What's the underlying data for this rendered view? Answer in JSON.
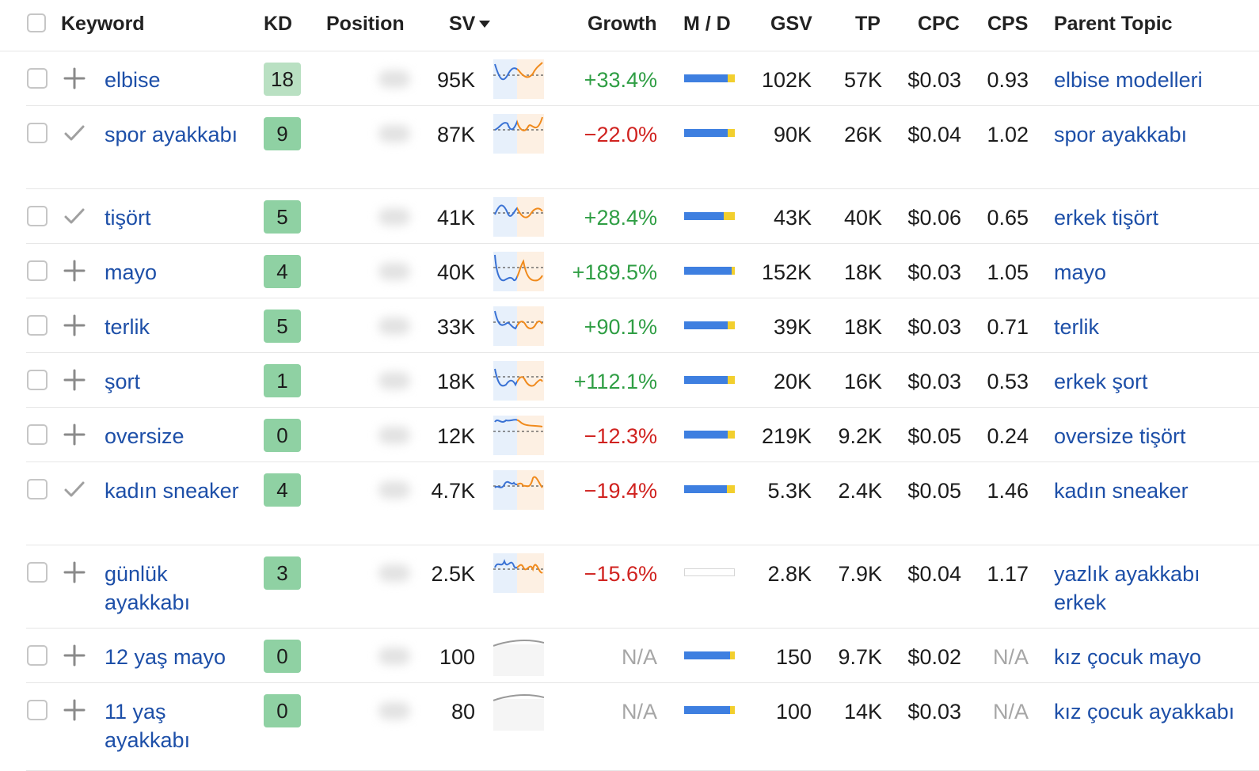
{
  "header": {
    "keyword": "Keyword",
    "kd": "KD",
    "position": "Position",
    "sv": "SV",
    "growth": "Growth",
    "md": "M / D",
    "gsv": "GSV",
    "tp": "TP",
    "cpc": "CPC",
    "cps": "CPS",
    "parent": "Parent Topic"
  },
  "colors": {
    "link": "#1d4fa8",
    "positive": "#2f9e44",
    "negative": "#d0221f",
    "kd_light": "#b9e0c2",
    "kd_green": "#8fd1a3",
    "md_mobile": "#3e7fe0",
    "md_desktop": "#f2cf2e"
  },
  "rows": [
    {
      "keyword": "elbise",
      "action": "plus-icon",
      "kd": "18",
      "sv": "95K",
      "growth": "+33.4%",
      "growth_type": "positive",
      "trend": "seasonal",
      "md_mobile": 0.86,
      "gsv": "102K",
      "tp": "57K",
      "cpc": "$0.03",
      "cps": "0.93",
      "parent": "elbise modelleri"
    },
    {
      "keyword": "spor ayakkabı",
      "action": "check-icon",
      "kd": "9",
      "sv": "87K",
      "growth": "−22.0%",
      "growth_type": "negative",
      "trend": "seasonal",
      "md_mobile": 0.86,
      "gsv": "90K",
      "tp": "26K",
      "cpc": "$0.04",
      "cps": "1.02",
      "parent": "spor ayakkabı"
    },
    {
      "keyword": "tişört",
      "action": "check-icon",
      "kd": "5",
      "sv": "41K",
      "growth": "+28.4%",
      "growth_type": "positive",
      "trend": "seasonal",
      "md_mobile": 0.78,
      "gsv": "43K",
      "tp": "40K",
      "cpc": "$0.06",
      "cps": "0.65",
      "parent": "erkek tişört"
    },
    {
      "keyword": "mayo",
      "action": "plus-icon",
      "kd": "4",
      "sv": "40K",
      "growth": "+189.5%",
      "growth_type": "positive",
      "trend": "seasonal",
      "md_mobile": 0.94,
      "gsv": "152K",
      "tp": "18K",
      "cpc": "$0.03",
      "cps": "1.05",
      "parent": "mayo"
    },
    {
      "keyword": "terlik",
      "action": "plus-icon",
      "kd": "5",
      "sv": "33K",
      "growth": "+90.1%",
      "growth_type": "positive",
      "trend": "seasonal",
      "md_mobile": 0.86,
      "gsv": "39K",
      "tp": "18K",
      "cpc": "$0.03",
      "cps": "0.71",
      "parent": "terlik"
    },
    {
      "keyword": "şort",
      "action": "plus-icon",
      "kd": "1",
      "sv": "18K",
      "growth": "+112.1%",
      "growth_type": "positive",
      "trend": "seasonal",
      "md_mobile": 0.86,
      "gsv": "20K",
      "tp": "16K",
      "cpc": "$0.03",
      "cps": "0.53",
      "parent": "erkek şort"
    },
    {
      "keyword": "oversize",
      "action": "plus-icon",
      "kd": "0",
      "sv": "12K",
      "growth": "−12.3%",
      "growth_type": "negative",
      "trend": "seasonal",
      "md_mobile": 0.86,
      "gsv": "219K",
      "tp": "9.2K",
      "cpc": "$0.05",
      "cps": "0.24",
      "parent": "oversize tişört"
    },
    {
      "keyword": "kadın sneaker",
      "action": "check-icon",
      "kd": "4",
      "sv": "4.7K",
      "growth": "−19.4%",
      "growth_type": "negative",
      "trend": "seasonal",
      "md_mobile": 0.84,
      "gsv": "5.3K",
      "tp": "2.4K",
      "cpc": "$0.05",
      "cps": "1.46",
      "parent": "kadın sneaker"
    },
    {
      "keyword": "günlük ayakkabı",
      "action": "plus-icon",
      "kd": "3",
      "sv": "2.5K",
      "growth": "−15.6%",
      "growth_type": "negative",
      "trend": "seasonal",
      "md_mobile": 0,
      "gsv": "2.8K",
      "tp": "7.9K",
      "cpc": "$0.04",
      "cps": "1.17",
      "parent": "yazlık ayakkabı erkek"
    },
    {
      "keyword": "12 yaş mayo",
      "action": "plus-icon",
      "kd": "0",
      "sv": "100",
      "growth": "N/A",
      "growth_type": "na",
      "trend": "flat",
      "md_mobile": 0.9,
      "gsv": "150",
      "tp": "9.7K",
      "cpc": "$0.02",
      "cps": "N/A",
      "parent": "kız çocuk mayo"
    },
    {
      "keyword": "11 yaş ayakkabı",
      "action": "plus-icon",
      "kd": "0",
      "sv": "80",
      "growth": "N/A",
      "growth_type": "na",
      "trend": "flat",
      "md_mobile": 0.9,
      "gsv": "100",
      "tp": "14K",
      "cpc": "$0.03",
      "cps": "N/A",
      "parent": "kız çocuk ayakkabı"
    }
  ]
}
